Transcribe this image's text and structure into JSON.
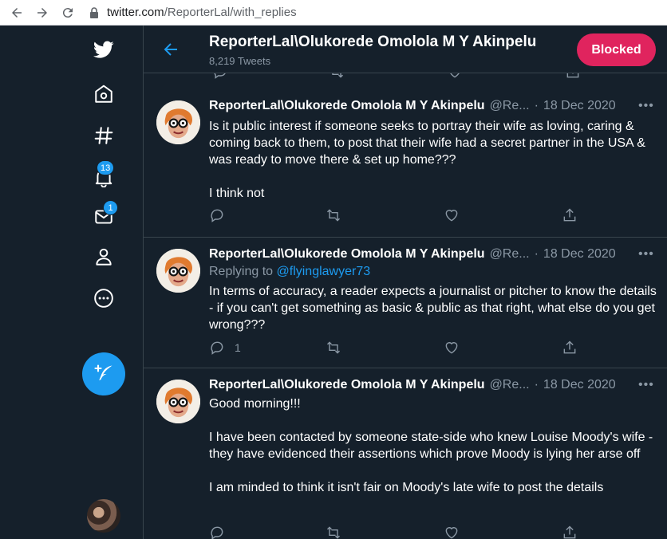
{
  "browser": {
    "url_host": "twitter.com",
    "url_path": "/ReporterLal/with_replies"
  },
  "sidebar": {
    "notifications_badge": "13",
    "messages_badge": "1"
  },
  "header": {
    "title": "ReporterLal\\Olukorede Omolola M Y Akinpelu",
    "tweet_count": "8,219 Tweets",
    "blocked_label": "Blocked"
  },
  "tweets": [
    {
      "name": "ReporterLal\\Olukorede Omolola M Y Akinpelu",
      "handle": "@Re...",
      "date": "18 Dec 2020",
      "replying_prefix": "",
      "replying_mention": "",
      "paragraphs": [
        "Is it public interest if someone seeks to portray their wife as loving, caring & coming back to them, to post that their wife had a secret partner in the USA & was ready to move there & set up home???",
        "",
        "I think not"
      ],
      "reply_count": ""
    },
    {
      "name": "ReporterLal\\Olukorede Omolola M Y Akinpelu",
      "handle": "@Re...",
      "date": "18 Dec 2020",
      "replying_prefix": "Replying to",
      "replying_mention": "@flyinglawyer73",
      "paragraphs": [
        "In terms of accuracy, a reader expects a journalist or pitcher to know the details - if you can't get something as basic & public as that right, what else do you get wrong???"
      ],
      "reply_count": "1"
    },
    {
      "name": "ReporterLal\\Olukorede Omolola M Y Akinpelu",
      "handle": "@Re...",
      "date": "18 Dec 2020",
      "replying_prefix": "",
      "replying_mention": "",
      "paragraphs": [
        "Good morning!!!",
        "",
        "I have been contacted by someone state-side who knew Louise Moody's wife - they have evidenced their assertions which prove Moody is lying her arse off",
        "",
        "I am minded to think it isn't fair on Moody's late wife to post the details"
      ],
      "reply_count": ""
    }
  ]
}
